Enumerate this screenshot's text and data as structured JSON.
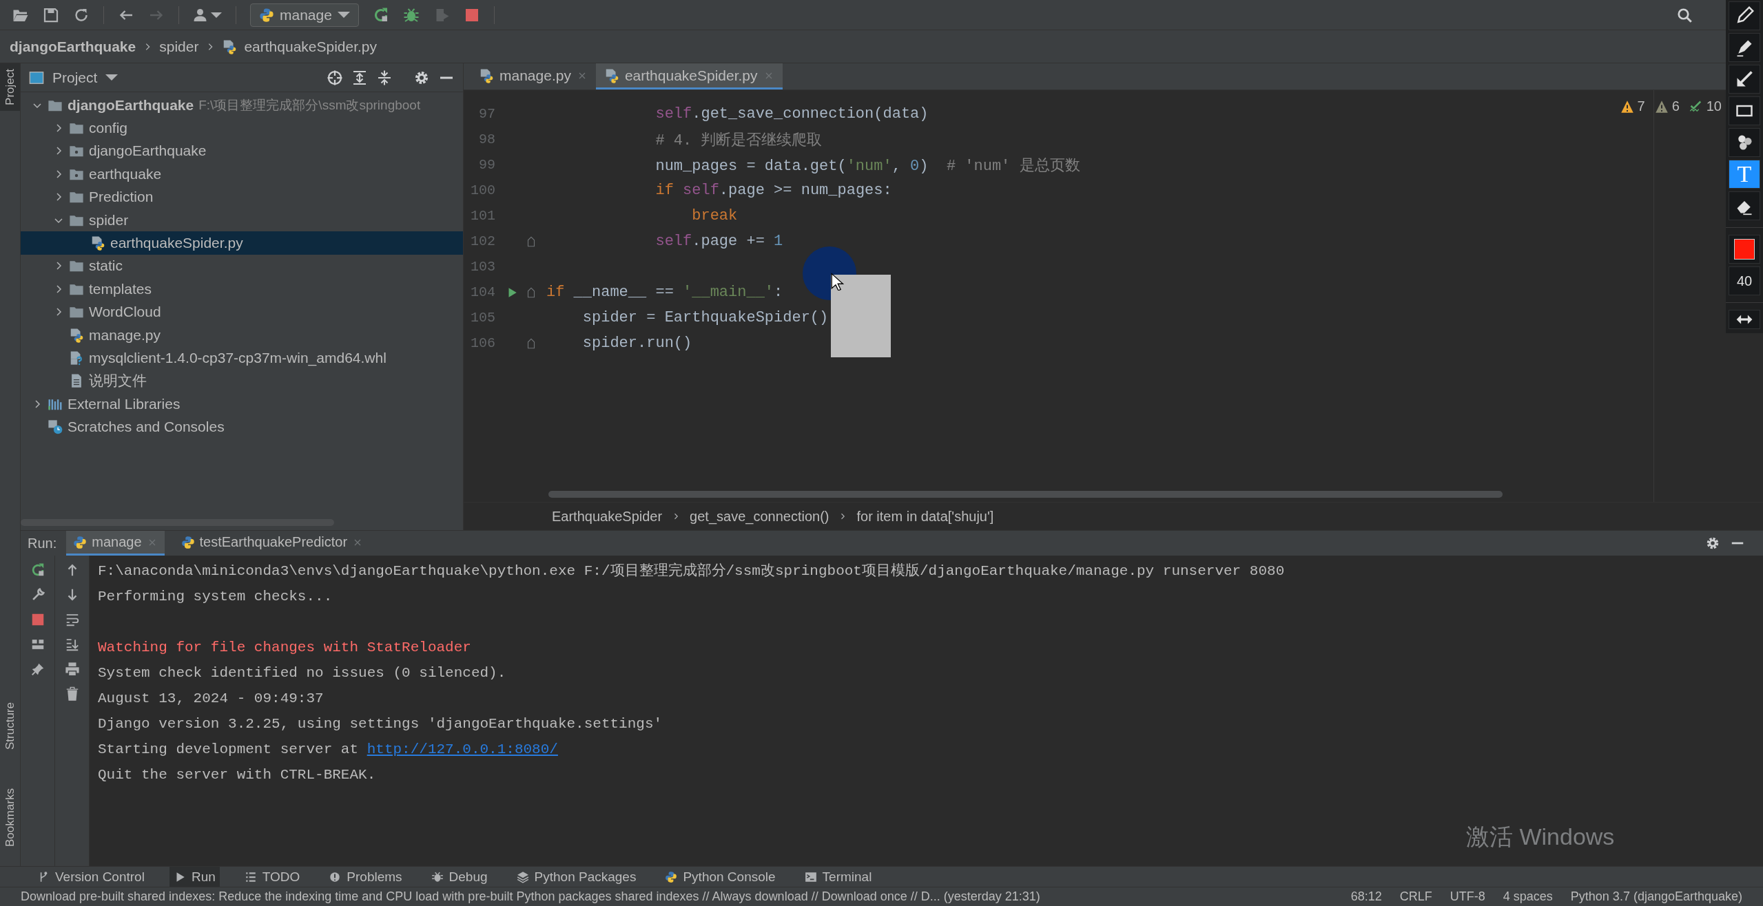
{
  "toolbar": {
    "run_config": "manage"
  },
  "navigation_bar": {
    "crumbs": [
      "djangoEarthquake",
      "spider",
      "earthquakeSpider.py"
    ]
  },
  "left_stripe": {
    "tabs": [
      {
        "label": "Project",
        "selected": true
      },
      {
        "label": "Structure",
        "selected": false
      },
      {
        "label": "Bookmarks",
        "selected": false
      }
    ]
  },
  "project_panel": {
    "title": "Project",
    "tree": [
      {
        "label": "djangoEarthquake",
        "path": "F:\\项目整理完成部分\\ssm改springboot",
        "kind": "folder",
        "expanded": true,
        "selected": false,
        "children": [
          {
            "label": "config",
            "kind": "folder",
            "expanded": false,
            "selected": false
          },
          {
            "label": "djangoEarthquake",
            "kind": "package",
            "expanded": false,
            "selected": false
          },
          {
            "label": "earthquake",
            "kind": "package",
            "expanded": false,
            "selected": false
          },
          {
            "label": "Prediction",
            "kind": "folder",
            "expanded": false,
            "selected": false
          },
          {
            "label": "spider",
            "kind": "folder",
            "expanded": true,
            "selected": false,
            "children": [
              {
                "label": "earthquakeSpider.py",
                "kind": "python",
                "selected": true
              }
            ]
          },
          {
            "label": "static",
            "kind": "folder",
            "expanded": false,
            "selected": false
          },
          {
            "label": "templates",
            "kind": "folder",
            "expanded": false,
            "selected": false
          },
          {
            "label": "WordCloud",
            "kind": "folder",
            "expanded": false,
            "selected": false
          },
          {
            "label": "manage.py",
            "kind": "python",
            "selected": false
          },
          {
            "label": "mysqlclient-1.4.0-cp37-cp37m-win_amd64.whl",
            "kind": "wheel",
            "selected": false
          },
          {
            "label": "说明文件",
            "kind": "text",
            "selected": false
          }
        ]
      },
      {
        "label": "External Libraries",
        "kind": "library",
        "expanded": false,
        "selected": false
      },
      {
        "label": "Scratches and Consoles",
        "kind": "scratches",
        "selected": false
      }
    ]
  },
  "editor": {
    "tabs": [
      {
        "label": "manage.py",
        "selected": false
      },
      {
        "label": "earthquakeSpider.py",
        "selected": true
      }
    ],
    "inspections": [
      {
        "kind": "warning",
        "count": "7"
      },
      {
        "kind": "weak_warning",
        "count": "6"
      },
      {
        "kind": "typo",
        "count": "10"
      }
    ],
    "lines": [
      {
        "number": "97",
        "run": false,
        "fold": false,
        "tokens": [
          {
            "text": "            self",
            "kind": "self"
          },
          {
            "text": ".get_save_connection(data)",
            "kind": "plain"
          }
        ]
      },
      {
        "number": "98",
        "run": false,
        "fold": false,
        "tokens": [
          {
            "text": "            # 4. 判断是否继续爬取",
            "kind": "comment"
          }
        ]
      },
      {
        "number": "99",
        "run": false,
        "fold": false,
        "tokens": [
          {
            "text": "            num_pages = data.get(",
            "kind": "plain"
          },
          {
            "text": "'num'",
            "kind": "string"
          },
          {
            "text": ", ",
            "kind": "plain"
          },
          {
            "text": "0",
            "kind": "number"
          },
          {
            "text": ")  ",
            "kind": "plain"
          },
          {
            "text": "# 'num' 是总页数",
            "kind": "comment"
          }
        ]
      },
      {
        "number": "100",
        "run": false,
        "fold": false,
        "tokens": [
          {
            "text": "            if",
            "kind": "keyword"
          },
          {
            "text": " self",
            "kind": "self"
          },
          {
            "text": ".page >= num_pages:",
            "kind": "plain"
          }
        ]
      },
      {
        "number": "101",
        "run": false,
        "fold": false,
        "tokens": [
          {
            "text": "                break",
            "kind": "keyword"
          }
        ]
      },
      {
        "number": "102",
        "run": false,
        "fold": true,
        "tokens": [
          {
            "text": "            self",
            "kind": "self"
          },
          {
            "text": ".page += ",
            "kind": "plain"
          },
          {
            "text": "1",
            "kind": "number"
          }
        ]
      },
      {
        "number": "103",
        "run": false,
        "fold": false
      },
      {
        "number": "104",
        "run": true,
        "fold": true,
        "tokens": [
          {
            "text": "if",
            "kind": "keyword"
          },
          {
            "text": " __name__ == ",
            "kind": "plain"
          },
          {
            "text": "'__main__'",
            "kind": "string"
          },
          {
            "text": ":",
            "kind": "plain"
          }
        ]
      },
      {
        "number": "105",
        "run": false,
        "fold": false,
        "tokens": [
          {
            "text": "    spider = EarthquakeSpider()",
            "kind": "plain"
          }
        ]
      },
      {
        "number": "106",
        "run": false,
        "fold": true,
        "tokens": [
          {
            "text": "    spider.run()",
            "kind": "plain"
          }
        ]
      }
    ],
    "breadcrumbs": [
      "EarthquakeSpider",
      "get_save_connection()",
      "for item in data['shuju']"
    ]
  },
  "run_panel": {
    "title": "Run:",
    "tabs": [
      {
        "label": "manage",
        "selected": true
      },
      {
        "label": "testEarthquakePredictor",
        "selected": false
      }
    ],
    "console": [
      {
        "kind": "plain",
        "text": "F:\\anaconda\\miniconda3\\envs\\djangoEarthquake\\python.exe F:/项目整理完成部分/ssm改springboot项目模版/djangoEarthquake/manage.py runserver 8080"
      },
      {
        "kind": "plain",
        "text": "Performing system checks..."
      },
      {
        "kind": "blank"
      },
      {
        "kind": "error",
        "text": "Watching for file changes with StatReloader"
      },
      {
        "kind": "plain",
        "text": "System check identified no issues (0 silenced)."
      },
      {
        "kind": "plain",
        "text": "August 13, 2024 - 09:49:37"
      },
      {
        "kind": "plain",
        "text": "Django version 3.2.25, using settings 'djangoEarthquake.settings'"
      },
      {
        "kind": "link",
        "text": "Starting development server at ",
        "link": "http://127.0.0.1:8080/"
      },
      {
        "kind": "plain",
        "text": "Quit the server with CTRL-BREAK."
      }
    ]
  },
  "tool_windows": [
    {
      "kind": "vcs",
      "label": "Version Control",
      "selected": false
    },
    {
      "kind": "run",
      "label": "Run",
      "selected": true
    },
    {
      "kind": "todo",
      "label": "TODO",
      "selected": false
    },
    {
      "kind": "problems",
      "label": "Problems",
      "selected": false
    },
    {
      "kind": "debug",
      "label": "Debug",
      "selected": false
    },
    {
      "kind": "packages",
      "label": "Python Packages",
      "selected": false
    },
    {
      "kind": "console",
      "label": "Python Console",
      "selected": false
    },
    {
      "kind": "terminal",
      "label": "Terminal",
      "selected": false
    }
  ],
  "status_bar": {
    "message": "Download pre-built shared indexes: Reduce the indexing time and CPU load with pre-built Python packages shared indexes // Always download // Download once // D... (yesterday 21:31)",
    "items": [
      "68:12",
      "CRLF",
      "UTF-8",
      "4 spaces",
      "Python 3.7 (djangoEarthquake)"
    ]
  },
  "drawing_toolbar": {
    "tools": [
      {
        "kind": "pencil",
        "selected": false
      },
      {
        "kind": "marker",
        "selected": false
      },
      {
        "kind": "arrow",
        "selected": false
      },
      {
        "kind": "rectangle",
        "selected": false
      },
      {
        "kind": "stamp",
        "selected": false
      },
      {
        "kind": "text",
        "label": "T",
        "selected": true
      },
      {
        "kind": "eraser",
        "selected": false
      }
    ],
    "size": "40"
  },
  "os_notice": "激活 Windows"
}
